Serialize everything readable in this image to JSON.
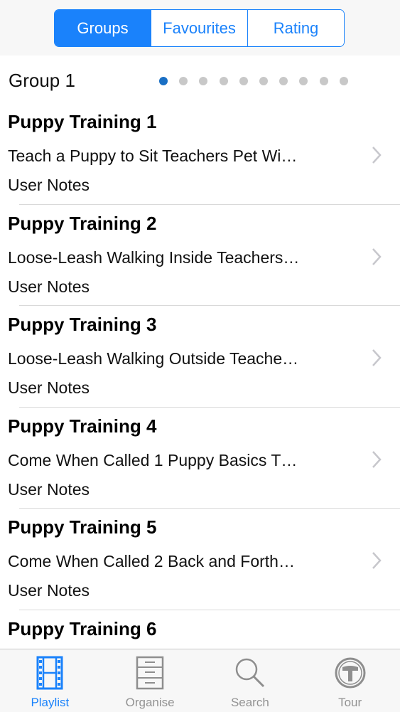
{
  "segmented": {
    "items": [
      "Groups",
      "Favourites",
      "Rating"
    ],
    "selected": "Groups"
  },
  "group": {
    "title": "Group 1",
    "page_count": 10,
    "current_page": 1
  },
  "list": [
    {
      "title": "Puppy Training 1",
      "subtitle": "Teach a Puppy to Sit  Teachers Pet Wi…",
      "notes": "User Notes"
    },
    {
      "title": "Puppy Training 2",
      "subtitle": "Loose-Leash Walking Inside  Teachers…",
      "notes": "User Notes"
    },
    {
      "title": "Puppy Training 3",
      "subtitle": "Loose-Leash Walking Outside  Teache…",
      "notes": "User Notes"
    },
    {
      "title": "Puppy Training 4",
      "subtitle": "Come When Called 1 Puppy Basics  T…",
      "notes": "User Notes"
    },
    {
      "title": "Puppy Training 5",
      "subtitle": "Come When Called 2 Back and Forth…",
      "notes": "User Notes"
    },
    {
      "title": "Puppy Training 6",
      "subtitle": "",
      "notes": ""
    }
  ],
  "tabbar": {
    "items": [
      {
        "label": "Playlist",
        "icon": "film-strip-icon",
        "active": true
      },
      {
        "label": "Organise",
        "icon": "cabinet-icon",
        "active": false
      },
      {
        "label": "Search",
        "icon": "magnifier-icon",
        "active": false
      },
      {
        "label": "Tour",
        "icon": "tour-icon",
        "active": false
      }
    ]
  },
  "colors": {
    "accent": "#1a82fb",
    "inactive": "#929292",
    "page_dot_active": "#1a6fc4",
    "page_dot": "#c8c8c8"
  }
}
